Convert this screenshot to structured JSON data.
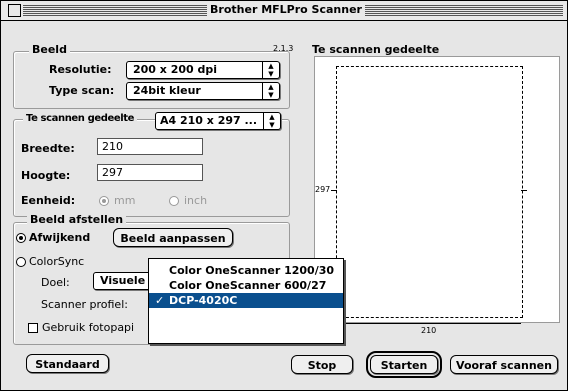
{
  "window": {
    "title": "Brother MFLPro Scanner",
    "version": "2.1.3"
  },
  "image_group": {
    "label": "Beeld",
    "resolution_label": "Resolutie:",
    "resolution_value": "200 x 200 dpi",
    "scan_type_label": "Type scan:",
    "scan_type_value": "24bit kleur"
  },
  "scan_area_group": {
    "label": "Te scannen gedeelte",
    "paper_value": "A4 210 x 297 ...",
    "width_label": "Breedte:",
    "width_value": "210",
    "height_label": "Hoogte:",
    "height_value": "297",
    "unit_label": "Eenheid:",
    "unit_mm": "mm",
    "unit_inch": "inch",
    "unit_selected": "mm"
  },
  "adjust_group": {
    "label": "Beeld afstellen",
    "deviating_label": "Afwijkend",
    "adjust_button": "Beeld aanpassen",
    "colorsync_label": "ColorSync",
    "target_label": "Doel:",
    "target_value": "Visuele",
    "scanner_profile_label": "Scanner profiel:",
    "use_photo_label": "Gebruik fotopapi"
  },
  "profile_menu": {
    "items": [
      "Color OneScanner 1200/30",
      "Color OneScanner 600/27",
      "DCP-4020C"
    ],
    "selected_index": 2
  },
  "preview": {
    "label": "Te scannen gedeelte",
    "height_mark": "297",
    "width_mark": "210"
  },
  "buttons": {
    "standard": "Standaard",
    "stop": "Stop",
    "start": "Starten",
    "prescan": "Vooraf scannen"
  },
  "colors": {
    "menu_highlight": "#0a4f8e",
    "window_bg": "#e6e6e6"
  }
}
